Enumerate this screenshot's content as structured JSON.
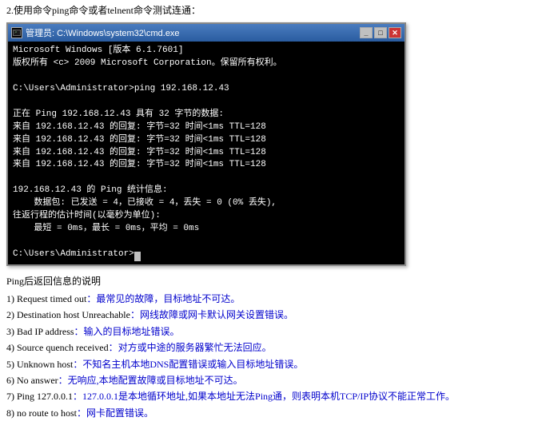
{
  "instruction": {
    "line1": "2.使用命令ping命令或者telnent命令测试连通："
  },
  "cmd_window": {
    "title": "管理员: C:\\Windows\\system32\\cmd.exe",
    "lines": [
      "Microsoft Windows [版本 6.1.7601]",
      "版权所有 <c> 2009 Microsoft Corporation。保留所有权利。",
      "",
      "C:\\Users\\Administrator>ping 192.168.12.43",
      "",
      "正在 Ping 192.168.12.43 具有 32 字节的数据:",
      "来自 192.168.12.43 的回复: 字节=32 时间<1ms TTL=128",
      "来自 192.168.12.43 的回复: 字节=32 时间<1ms TTL=128",
      "来自 192.168.12.43 的回复: 字节=32 时间<1ms TTL=128",
      "来自 192.168.12.43 的回复: 字节=32 时间<1ms TTL=128",
      "",
      "192.168.12.43 的 Ping 统计信息:",
      "    数据包: 已发送 = 4，已接收 = 4，丢失 = 0 (0% 丢失),",
      "往返行程的估计时间(以毫秒为单位):",
      "    最短 = 0ms，最长 = 0ms，平均 = 0ms",
      "",
      "C:\\Users\\Administrator>"
    ]
  },
  "ping_section": {
    "title": "Ping后返回信息的说明",
    "items": [
      {
        "num": "1)",
        "label": "Request timed out",
        "desc": "：最常见的故障，目标地址不可达。"
      },
      {
        "num": "2)",
        "label": "Destination host Unreachable",
        "desc": "：网线故障或网卡默认网关设置错误。"
      },
      {
        "num": "3)",
        "label": "Bad IP address",
        "desc": "：输入的目标地址错误。"
      },
      {
        "num": "4)",
        "label": "Source quench received",
        "desc": "：对方或中途的服务器繁忙无法回应。"
      },
      {
        "num": "5)",
        "label": "Unknown host",
        "desc": "：不知名主机本地DNS配置错误或输入目标地址错误。"
      },
      {
        "num": "6)",
        "label": "No answer",
        "desc": "：无响应,本地配置故障或目标地址不可达。"
      },
      {
        "num": "7)",
        "label": "Ping 127.0.0.1",
        "desc": "：127.0.0.1是本地循环地址,如果本地址无法Ping通，则表明本机TCP/IP协议不能正常工作。"
      },
      {
        "num": "8)",
        "label": "no route to host",
        "desc": "：网卡配置错误。"
      }
    ]
  }
}
